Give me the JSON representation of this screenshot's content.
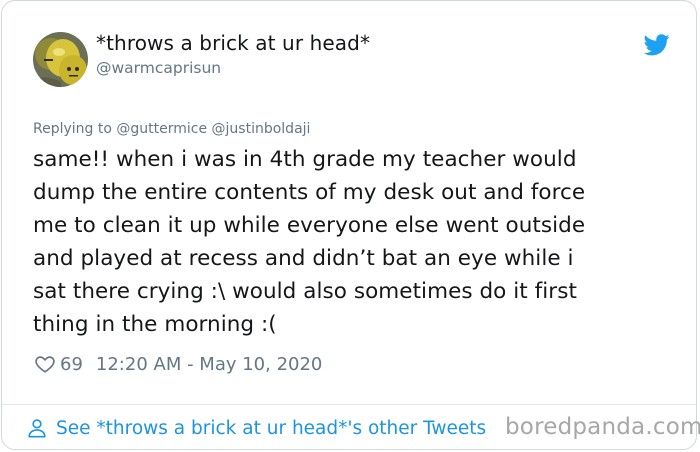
{
  "tweet": {
    "display_name": "*throws a brick at ur head*",
    "handle": "@warmcaprisun",
    "replying_to": "Replying to @guttermice @justinboldaji",
    "text": "same!! when i was in 4th grade my teacher would\ndump the entire contents of my desk out and force\nme to clean it up while everyone else went outside\nand played at recess and didn’t bat an eye while i\nsat there crying :\\ would also sometimes do it first\nthing in the morning :(",
    "likes": "69",
    "timestamp": "12:20 AM - May 10, 2020"
  },
  "footer": {
    "link_label": "See *throws a brick at ur head*'s other Tweets"
  },
  "watermark": "boredpanda.com",
  "icons": {
    "avatar": "avatar-yellow-balloons",
    "logo": "twitter-bird-icon",
    "like": "heart-outline-icon",
    "profile": "person-outline-icon"
  },
  "colors": {
    "text": "#14171a",
    "muted": "#657786",
    "link": "#1b95e0",
    "twitter_blue": "#1da1f2",
    "border": "#cfd9de"
  }
}
